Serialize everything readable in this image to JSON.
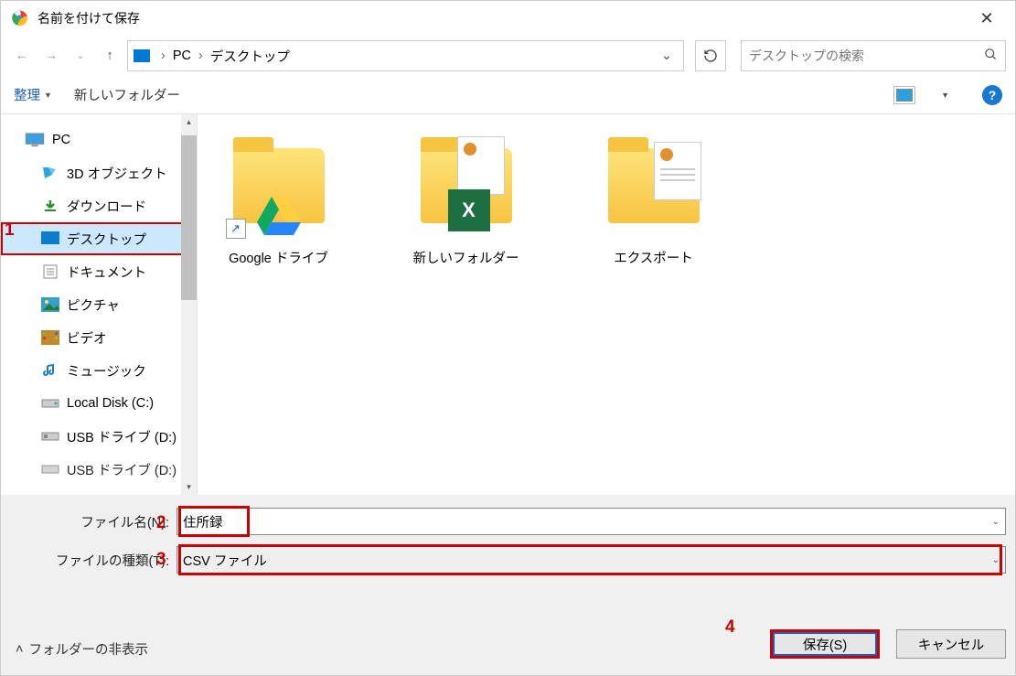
{
  "title": "名前を付けて保存",
  "breadcrumb": {
    "root": "PC",
    "folder": "デスクトップ"
  },
  "search_placeholder": "デスクトップの検索",
  "toolbar": {
    "organize": "整理",
    "new_folder": "新しいフォルダー"
  },
  "tree": {
    "pc": "PC",
    "items": [
      "3D オブジェクト",
      "ダウンロード",
      "デスクトップ",
      "ドキュメント",
      "ピクチャ",
      "ビデオ",
      "ミュージック",
      "Local Disk (C:)",
      "USB ドライブ (D:)",
      "USB ドライブ (D:)"
    ]
  },
  "files": [
    {
      "name": "Google ドライブ",
      "kind": "drive"
    },
    {
      "name": "新しいフォルダー",
      "kind": "excel"
    },
    {
      "name": "エクスポート",
      "kind": "doc"
    }
  ],
  "filename_label": "ファイル名(N):",
  "filename_value": "住所録",
  "filetype_label": "ファイルの種類(T):",
  "filetype_value": "CSV ファイル",
  "hide_folders": "フォルダーの非表示",
  "buttons": {
    "save": "保存(S)",
    "cancel": "キャンセル"
  },
  "annotations": {
    "n1": "1",
    "n2": "2",
    "n3": "3",
    "n4": "4"
  }
}
